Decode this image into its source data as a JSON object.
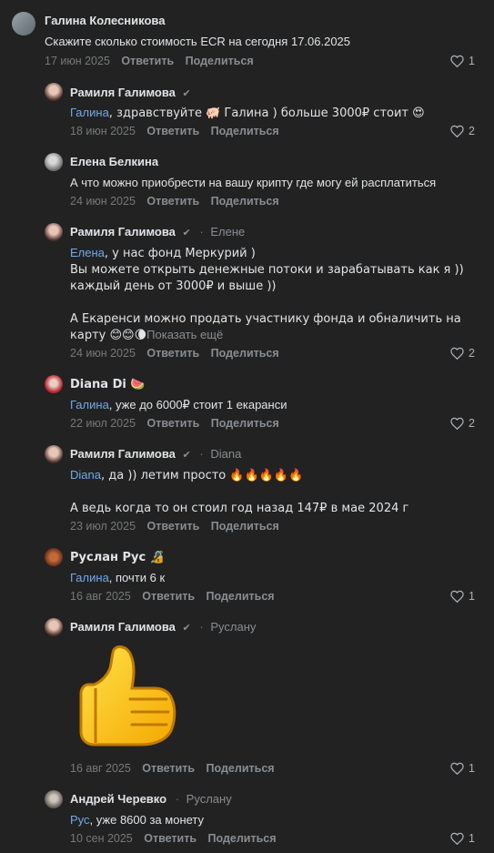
{
  "actions": {
    "reply": "Ответить",
    "share": "Поделиться"
  },
  "comments": [
    {
      "author": "Галина Колесникова",
      "text": "Скажите сколько стоимость ECR на сегодня 17.06.2025",
      "date": "17 июн 2025",
      "likes": "1"
    },
    {
      "author": "Рамиля Галимова",
      "mention": "Галина",
      "text": ", здравствуйте 🐖 Галина ) больше 3000₽ стоит 😍",
      "date": "18 июн 2025",
      "likes": "2"
    },
    {
      "author": "Елена Белкина",
      "text": "А что можно приобрести на вашу крипту где могу ей расплатиться",
      "date": "24 июн 2025",
      "likes": ""
    },
    {
      "author": "Рамиля Галимова",
      "reply_to": "Елене",
      "mention": "Елена",
      "text": ", у нас фонд Меркурий )\nВы можете открыть денежные потоки и зарабатывать как я ))\nкаждый день от 3000₽ и выше ))\n\nА Екаренси можно продать участнику фонда и обналичить на\nкарту 😊😊🌘",
      "show_more": "Показать ещё",
      "date": "24 июн 2025",
      "likes": "2"
    },
    {
      "author": "Diana Di 🍉",
      "mention": "Галина",
      "text": ", уже до 6000₽ стоит 1 екаранси",
      "date": "22 июл 2025",
      "likes": "2"
    },
    {
      "author": "Рамиля Галимова",
      "reply_to": "Diana",
      "mention": "Diana",
      "text": ", да )) летим просто 🔥🔥🔥🔥🔥\n\nА ведь когда то он стоил год назад 147₽ в мае 2024 г",
      "date": "23 июл 2025",
      "likes": ""
    },
    {
      "author": "Руслан Рус 🔏",
      "mention": "Галина",
      "text": ", почти 6 к",
      "date": "16 авг 2025",
      "likes": "1"
    },
    {
      "author": "Рамиля Галимова",
      "reply_to": "Руслану",
      "sticker": "thumbs-up",
      "date": "16 авг 2025",
      "likes": "1"
    },
    {
      "author": "Андрей Черевко",
      "reply_to": "Руслану",
      "mention": "Рус",
      "text": ", уже 8600 за монету",
      "date": "10 сен 2025",
      "likes": "1"
    }
  ]
}
